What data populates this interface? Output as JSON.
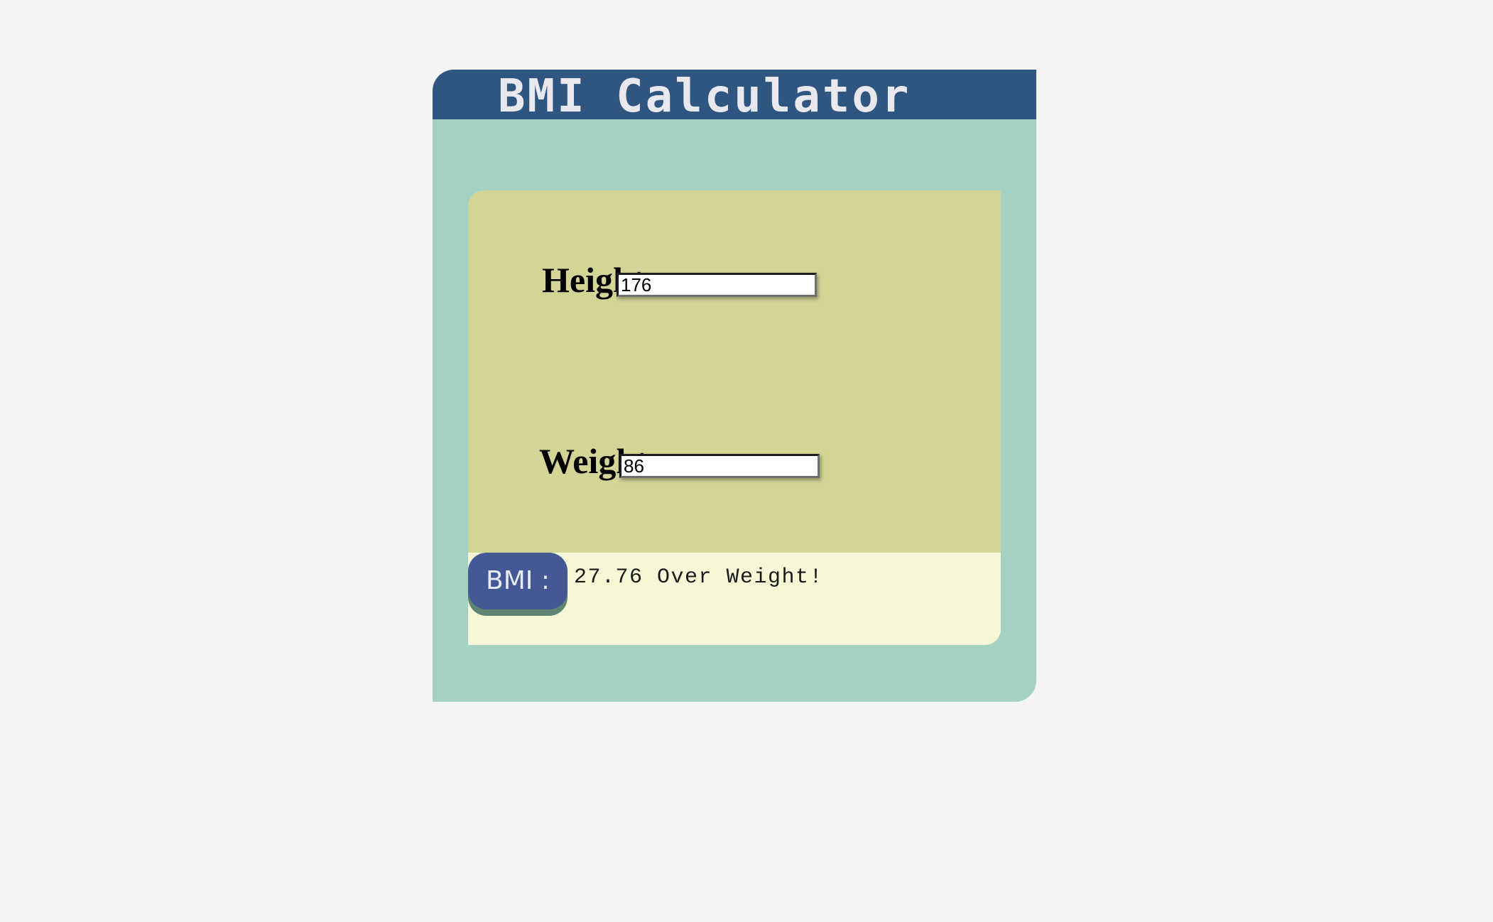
{
  "app": {
    "title": "BMI Calculator"
  },
  "form": {
    "height": {
      "label": "Height:",
      "value": "176"
    },
    "weight": {
      "label": "Weight:",
      "value": "86"
    }
  },
  "result": {
    "button_label": "BMI :",
    "text": "27.76 Over Weight!"
  },
  "colors": {
    "page_background": "#f4f4f4",
    "card_background": "#a5d1c3",
    "header_background": "#2e5680",
    "form_panel": "#d3d596",
    "result_panel": "#f5f7d7",
    "button_background": "#435895",
    "button_shadow": "#5d8571"
  }
}
